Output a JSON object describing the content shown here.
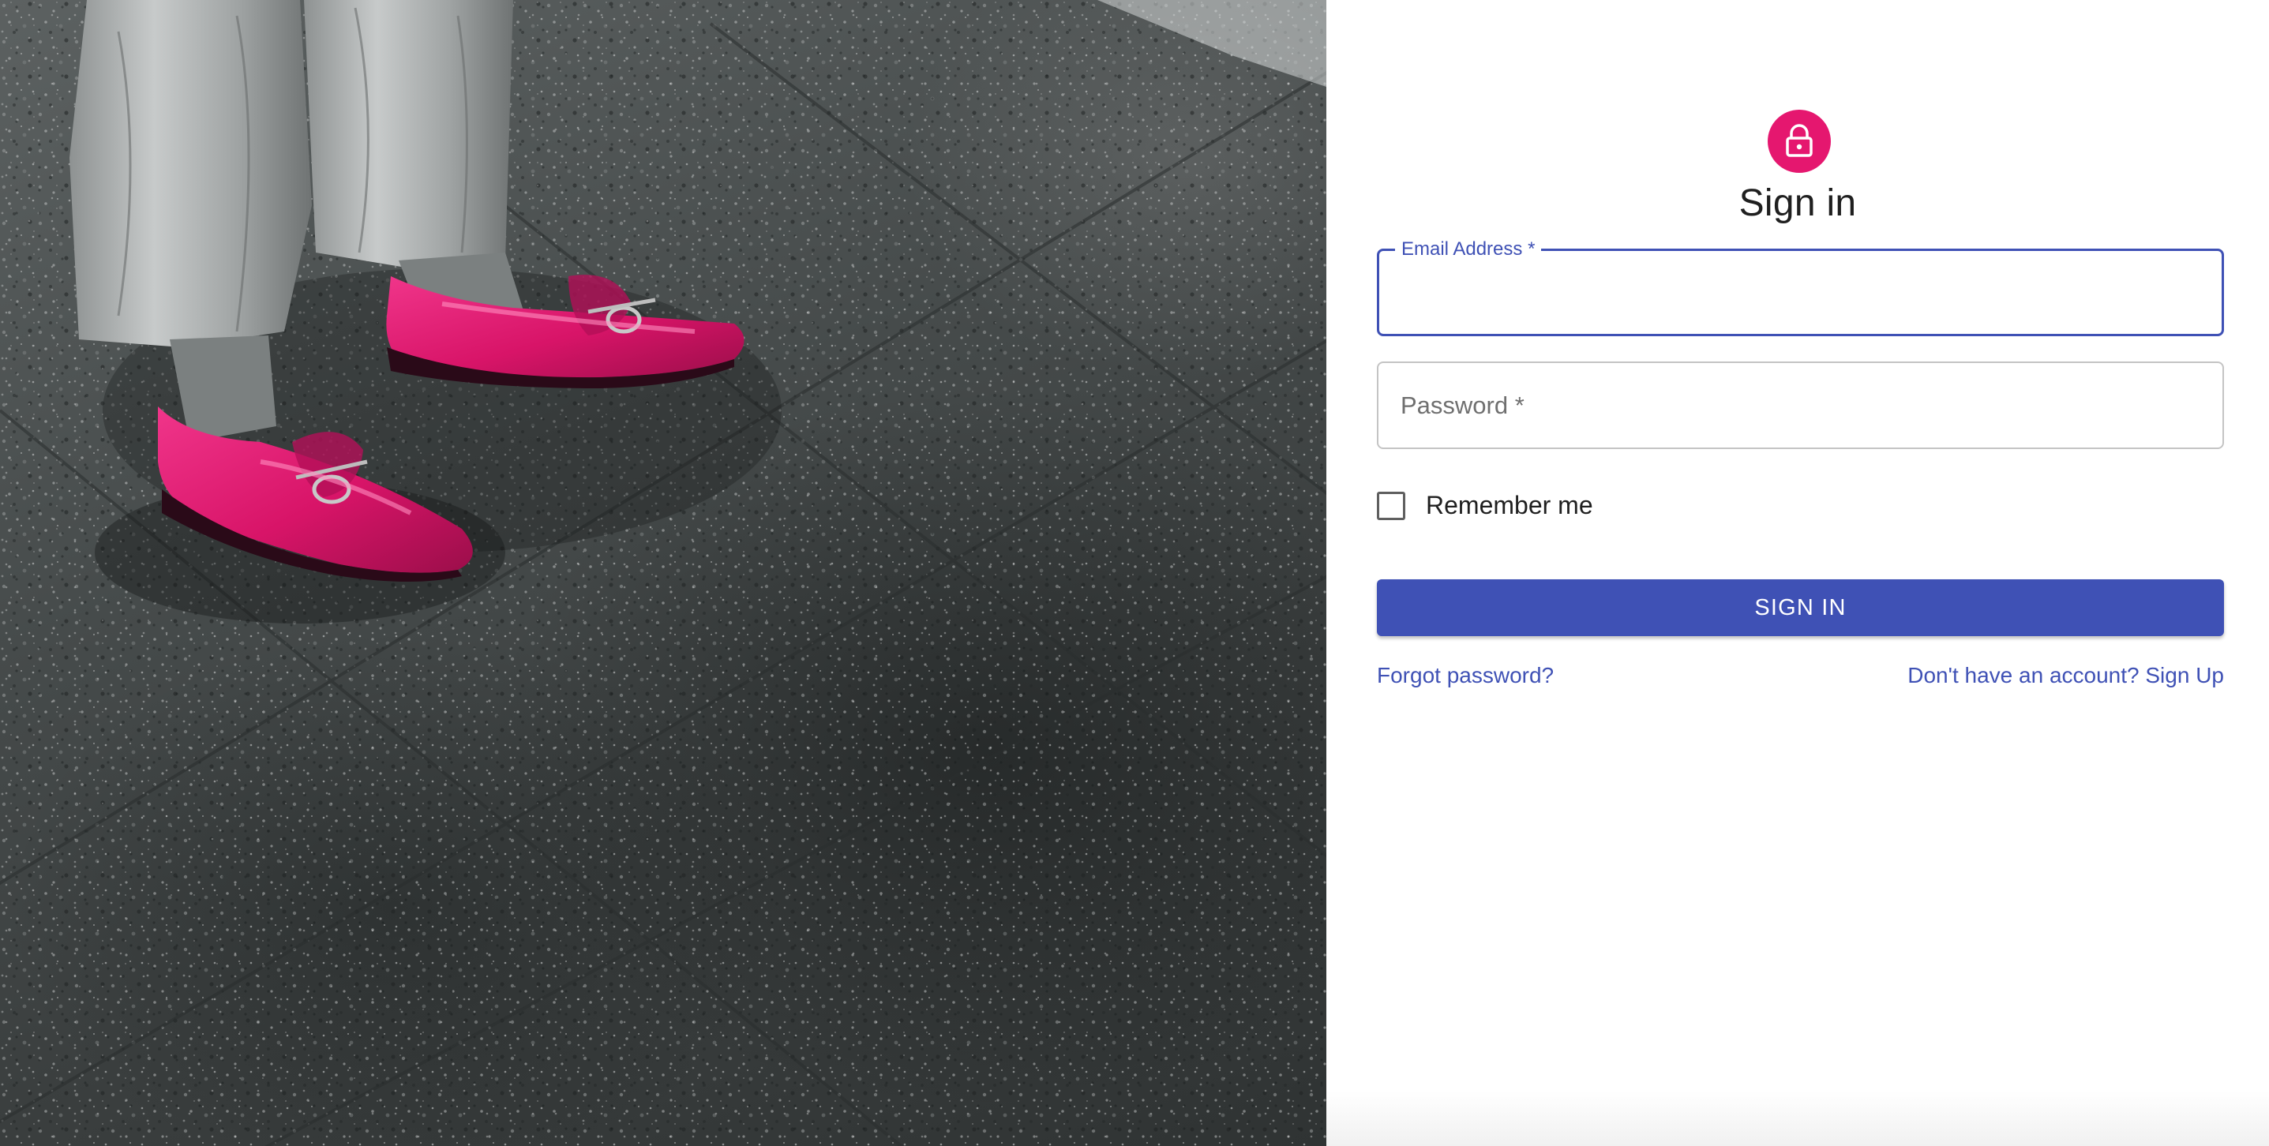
{
  "hero": {
    "alt": "person wearing pink loafers standing on terrazzo floor"
  },
  "form": {
    "title": "Sign in",
    "email_label": "Email Address *",
    "password_label": "Password *",
    "remember_label": "Remember me",
    "submit_label": "SIGN IN",
    "forgot_link": "Forgot password?",
    "signup_link": "Don't have an account? Sign Up"
  },
  "colors": {
    "primary": "#3f51b5",
    "avatar": "#e5176f",
    "shoe": "#e0186e"
  },
  "icons": {
    "avatar_icon": "lock-outlined-icon"
  }
}
